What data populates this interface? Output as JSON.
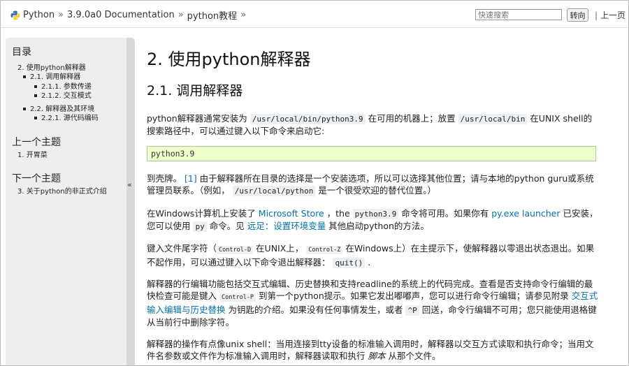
{
  "header": {
    "crumbs": [
      "Python",
      "3.9.0a0 Documentation",
      "python教程"
    ],
    "separator": "»",
    "search_placeholder": "快速搜索",
    "search_button": "转向",
    "prev_link": "上一页"
  },
  "sidebar": {
    "toc_title": "目录",
    "toc": [
      {
        "label": "2. 使用python解释器",
        "level": 0
      },
      {
        "label": "2.1. 调用解释器",
        "level": 1
      },
      {
        "label": "2.1.1. 参数传递",
        "level": 2
      },
      {
        "label": "2.1.2. 交互模式",
        "level": 2
      },
      {
        "label": "2.2. 解释器及其环境",
        "level": 1
      },
      {
        "label": "2.2.1. 源代码编码",
        "level": 2
      }
    ],
    "prev_title": "上一个主题",
    "prev_item": "1. 开胃菜",
    "next_title": "下一个主题",
    "next_item": "3. 关于python的非正式介绍",
    "collapse_glyph": "«"
  },
  "main": {
    "h1": "2. 使用python解释器",
    "h2": "2.1. 调用解释器",
    "p1": {
      "a": "python解释器通常安装为 ",
      "code1": "/usr/local/bin/python3.9",
      "b": " 在可用的机器上；放置 ",
      "code2": "/usr/local/bin",
      "c": " 在UNIX shell的搜索路径中，可以通过键入以下命令来启动它:"
    },
    "codeblock": "python3.9",
    "p2": {
      "a": "到壳牌。 ",
      "ref": "[1]",
      "b": " 由于解释器所在目录的选择是一个安装选项，所以可以选择其他位置；请与本地的python guru或系统管理员联系。（例如， ",
      "code": "/usr/local/python",
      "c": " 是一个很受欢迎的替代位置。）"
    },
    "p3": {
      "a": "在Windows计算机上安装了 ",
      "link1": "Microsoft Store",
      "b": " ，the ",
      "code1": "python3.9",
      "c": " 命令将可用。如果你有 ",
      "link2": "py.exe launcher",
      "d": " 已安装，您可以使用 ",
      "code2": "py",
      "e": " 命令。见 ",
      "link3": "远足：设置环境变量",
      "f": " 其他启动python的方法。"
    },
    "p4": {
      "a": "键入文件尾字符（",
      "code1": "Control-D",
      "b": " 在UNIX上， ",
      "code2": "Control-Z",
      "c": " 在Windows上）在主提示下，使解释器以零退出状态退出。如果不起作用，可以通过键入以下命令退出解释器： ",
      "code3": "quit()",
      "d": " ."
    },
    "p5": {
      "a": "解释器的行编辑功能包括交互式编辑、历史替换和支持readline的系统上的代码完成。查看是否支持命令行编辑的最快检查可能是键入 ",
      "code1": "Control-P",
      "b": " 到第一个python提示。如果它发出嘟嘟声，您可以进行命令行编辑；请参见附录 ",
      "link": "交互式输入编辑与历史替换",
      "c": " 为钥匙的介绍。如果没有任何事情发生，或者 ",
      "code2": "^P",
      "d": " 回送，命令行编辑不可用；您只能使用退格键从当前行中删除字符。"
    },
    "p6": {
      "a": "解释器的操作有点像unix shell：当用连接到tty设备的标准输入调用时，解释器以交互方式读取和执行命令；当用文件名参数或文件作为标准输入调用时，解释器读取和执行 ",
      "em": "脚本",
      "b": " 从那个文件。"
    }
  }
}
